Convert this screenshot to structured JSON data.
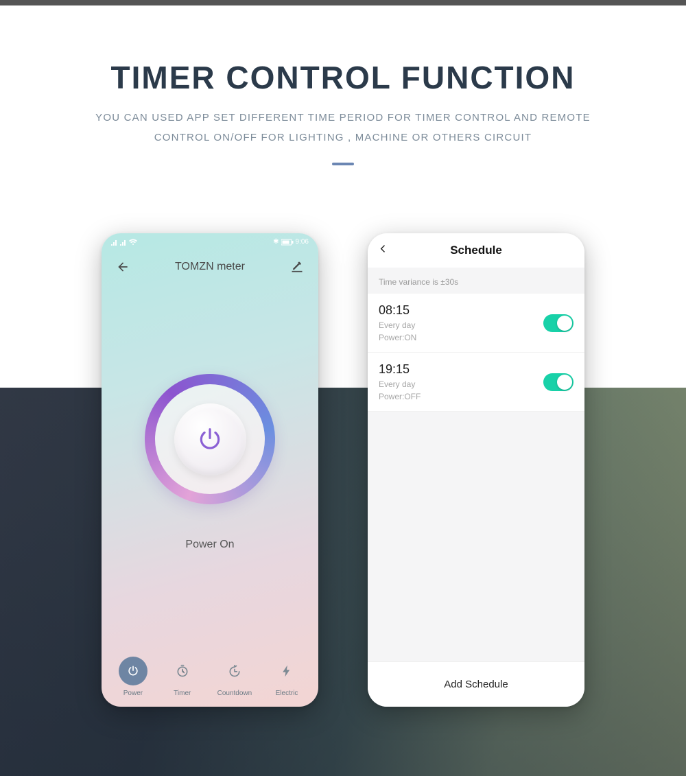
{
  "hero": {
    "title": "TIMER CONTROL FUNCTION",
    "subtitle_line1": "YOU CAN USED APP SET DIFFERENT TIME PERIOD FOR TIMER CONTROL AND REMOTE",
    "subtitle_line2": "CONTROL ON/OFF FOR LIGHTING , MACHINE OR OTHERS CIRCUIT"
  },
  "phone1": {
    "status_time": "9:06",
    "title": "TOMZN meter",
    "power_label": "Power On",
    "tabs": [
      {
        "label": "Power",
        "icon": "power"
      },
      {
        "label": "Timer",
        "icon": "timer"
      },
      {
        "label": "Countdown",
        "icon": "countdown"
      },
      {
        "label": "Electric",
        "icon": "bolt"
      }
    ]
  },
  "phone2": {
    "title": "Schedule",
    "variance": "Time variance is ±30s",
    "items": [
      {
        "time": "08:15",
        "repeat": "Every day",
        "power": "Power:ON",
        "on": true
      },
      {
        "time": "19:15",
        "repeat": "Every day",
        "power": "Power:OFF",
        "on": true
      }
    ],
    "add_label": "Add Schedule"
  }
}
